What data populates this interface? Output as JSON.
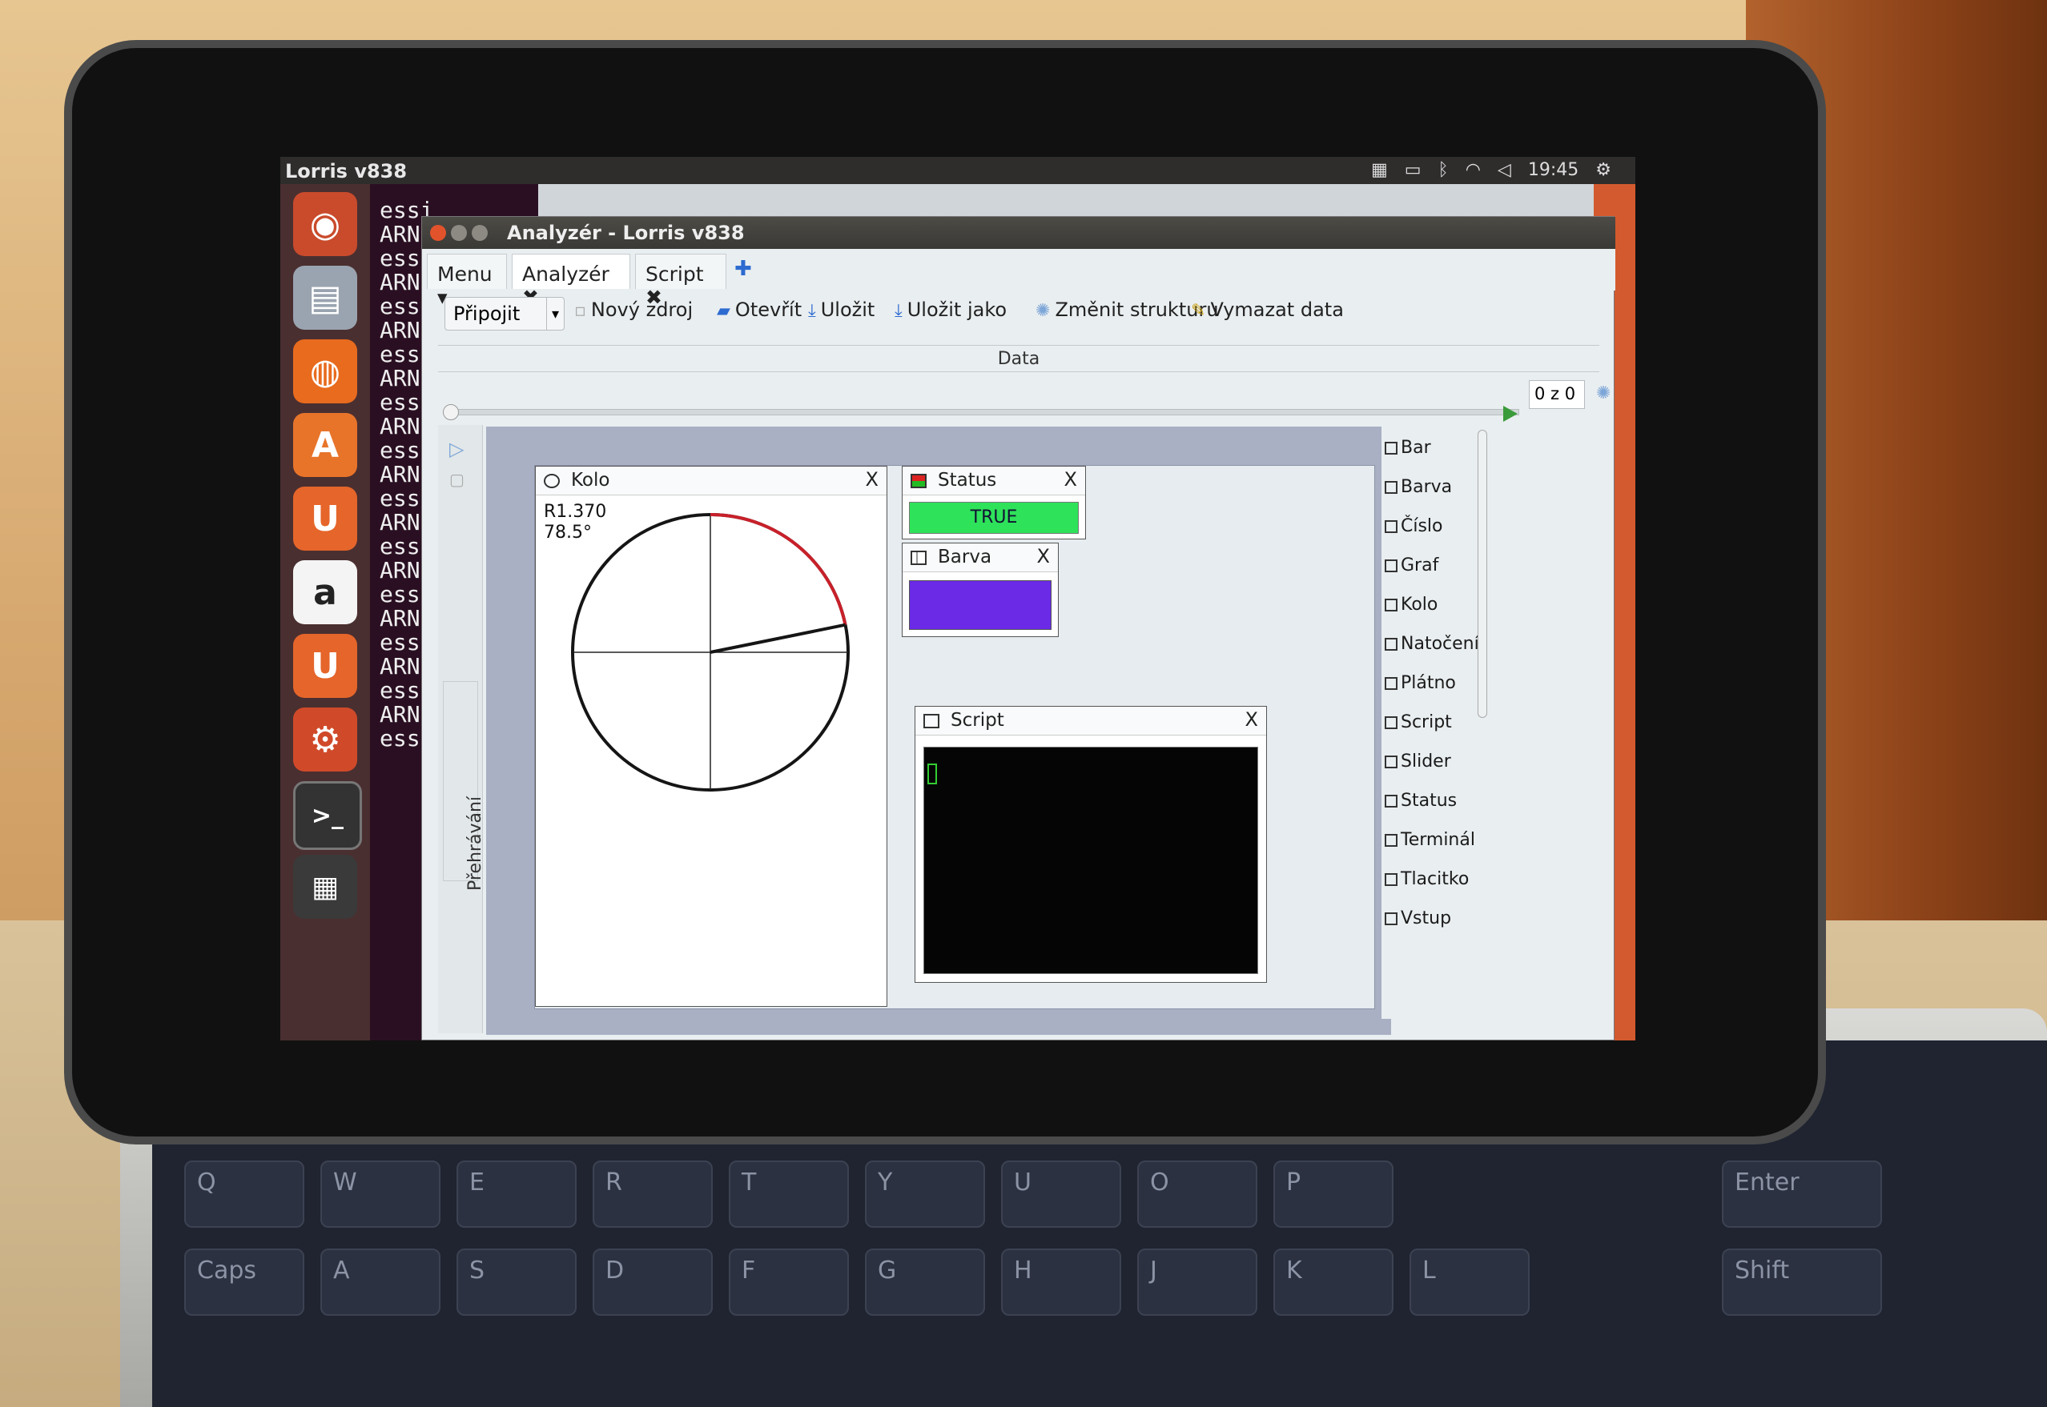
{
  "panel": {
    "app_title": "Lorris v838",
    "clock": "19:45",
    "tray_icons": [
      "grid-icon",
      "battery-icon",
      "bluetooth-icon",
      "wifi-icon",
      "volume-icon",
      "gear-icon"
    ]
  },
  "launcher": {
    "items": [
      "ubuntu-icon",
      "files-icon",
      "firefox-icon",
      "software-center-icon",
      "ubuntu-one-icon",
      "amazon-icon",
      "ubuntu-one-music-icon",
      "settings-icon",
      "terminal-icon",
      "video-icon"
    ]
  },
  "terminal": {
    "lines": [
      "essi",
      "ARNI",
      "essi",
      "ARNI",
      "essi",
      "ARNI",
      "essi",
      "ARNI",
      "essi",
      "ARNI",
      "essi",
      "ARNI",
      "essi",
      "ARNI",
      "essi",
      "ARNI",
      "essi",
      "ARNI",
      "essi",
      "ARNI",
      "essi",
      "ARNI",
      "essi"
    ]
  },
  "window": {
    "title": "Analyzér - Lorris v838",
    "tabs": {
      "menu": "Menu",
      "analyzer": "Analyzér",
      "script": "Script"
    },
    "toolbar": {
      "connect": "Připojit",
      "new_source": "Nový zdroj",
      "open": "Otevřít",
      "save": "Uložit",
      "save_as": "Uložit jako",
      "change_structure": "Změnit strukturu",
      "clear_data": "Vymazat data"
    },
    "data_label": "Data",
    "spin_value": "0 z 0",
    "playback_label": "Přehrávání"
  },
  "widgets": {
    "kolo": {
      "title": "Kolo",
      "value": "R1.370",
      "angle": "78.5°"
    },
    "status": {
      "title": "Status",
      "value": "TRUE"
    },
    "barva": {
      "title": "Barva"
    },
    "script": {
      "title": "Script"
    }
  },
  "palette": {
    "items": [
      "Bar",
      "Barva",
      "Číslo",
      "Graf",
      "Kolo",
      "Natočení",
      "Plátno",
      "Script",
      "Slider",
      "Status",
      "Terminál",
      "Tlacitko",
      "Vstup"
    ]
  },
  "colors": {
    "status_green": "#2ee25a",
    "barva_color": "#6a2ae6",
    "dial_arc": "#c8202a"
  }
}
